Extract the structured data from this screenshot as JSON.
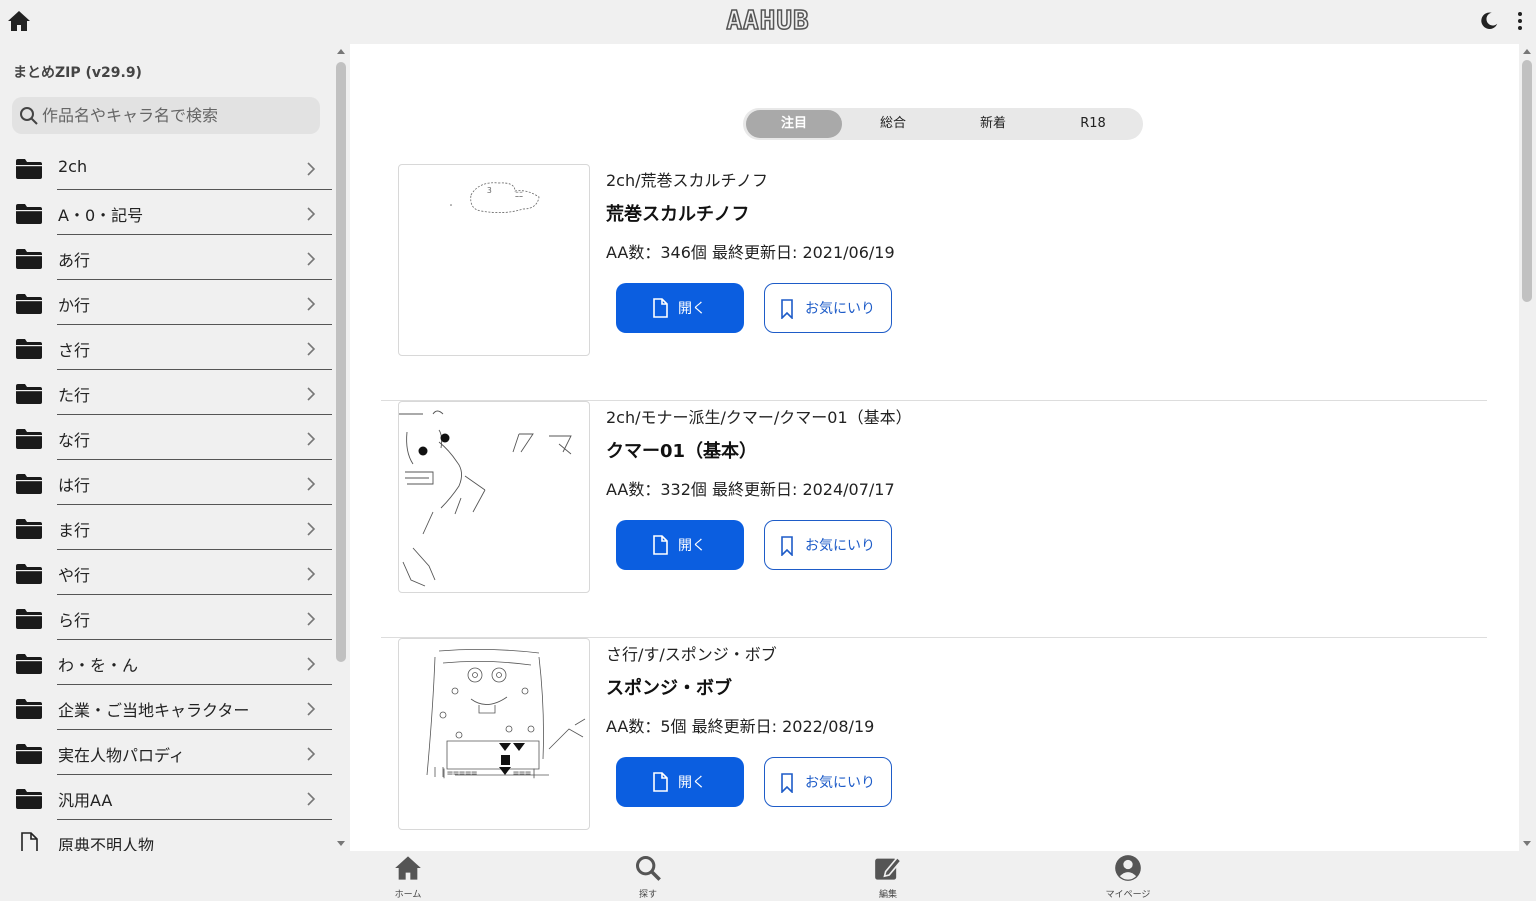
{
  "header": {
    "logo_text": "AAHUB",
    "home_icon": "home-icon",
    "theme_icon": "moon-icon",
    "menu_icon": "kebab-menu-icon"
  },
  "sidebar": {
    "title": "まとめZIP (v29.9)",
    "search_placeholder": "作品名やキャラ名で検索",
    "categories": [
      {
        "label": "2ch",
        "icon": "folder-icon"
      },
      {
        "label": "A・0・記号",
        "icon": "folder-icon"
      },
      {
        "label": "あ行",
        "icon": "folder-icon"
      },
      {
        "label": "か行",
        "icon": "folder-icon"
      },
      {
        "label": "さ行",
        "icon": "folder-icon"
      },
      {
        "label": "た行",
        "icon": "folder-icon"
      },
      {
        "label": "な行",
        "icon": "folder-icon"
      },
      {
        "label": "は行",
        "icon": "folder-icon"
      },
      {
        "label": "ま行",
        "icon": "folder-icon"
      },
      {
        "label": "や行",
        "icon": "folder-icon"
      },
      {
        "label": "ら行",
        "icon": "folder-icon"
      },
      {
        "label": "わ・を・ん",
        "icon": "folder-icon"
      },
      {
        "label": "企業・ご当地キャラクター",
        "icon": "folder-icon"
      },
      {
        "label": "実在人物パロディ",
        "icon": "folder-icon"
      },
      {
        "label": "汎用AA",
        "icon": "folder-icon"
      },
      {
        "label": "原典不明人物",
        "icon": "document-icon"
      }
    ]
  },
  "tabs": [
    {
      "label": "注目",
      "active": true
    },
    {
      "label": "総合",
      "active": false
    },
    {
      "label": "新着",
      "active": false
    },
    {
      "label": "R18",
      "active": false
    }
  ],
  "items": [
    {
      "path": "2ch/荒巻スカルチノフ",
      "name": "荒巻スカルチノフ",
      "meta": "AA数：346個  最終更新日: 2021/06/19",
      "open_label": "開く",
      "fav_label": "お気にいり"
    },
    {
      "path": "2ch/モナー派生/クマー/クマー01（基本）",
      "name": "クマー01（基本）",
      "meta": "AA数：332個  最終更新日: 2024/07/17",
      "open_label": "開く",
      "fav_label": "お気にいり"
    },
    {
      "path": "さ行/す/スポンジ・ボブ",
      "name": "スポンジ・ボブ",
      "meta": "AA数：5個  最終更新日: 2022/08/19",
      "open_label": "開く",
      "fav_label": "お気にいり"
    }
  ],
  "bottom_nav": [
    {
      "label": "ホーム",
      "icon": "home-icon"
    },
    {
      "label": "探す",
      "icon": "search-icon"
    },
    {
      "label": "編集",
      "icon": "edit-icon"
    },
    {
      "label": "マイページ",
      "icon": "user-icon"
    }
  ]
}
